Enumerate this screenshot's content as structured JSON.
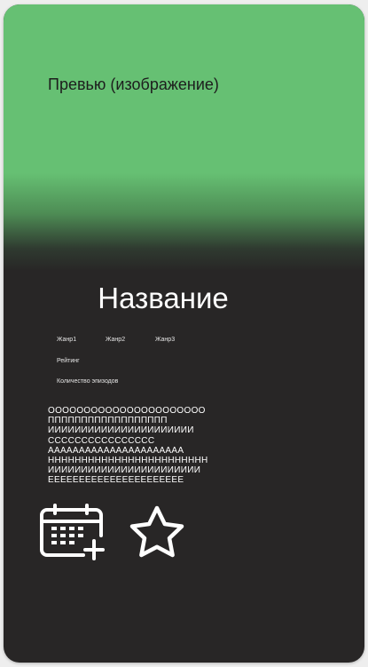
{
  "preview": {
    "label": "Превью (изображение)"
  },
  "title": "Название",
  "genres": [
    "Жанр1",
    "Жанр2",
    "Жанр3"
  ],
  "rating_label": "Рейтинг",
  "episodes_label": "Количество эпизодов",
  "description_lines": [
    "ОООООООООООООООООООООО",
    "ПППППППППППППППППП",
    "ИИИИИИИИИИИИИИИИИИИИИИ",
    "СССССССССССССССС",
    "АААААААААААААААААААААА",
    "НННННННННННННННННННННННН",
    "ИИИИИИИИИИИИИИИИИИИИИИИ",
    "ЕЕЕЕЕЕЕЕЕЕЕЕЕЕЕЕЕЕЕЕЕЕ"
  ],
  "actions": {
    "calendar_icon": "calendar-add-icon",
    "star_icon": "star-outline-icon"
  },
  "colors": {
    "preview_green": "#66c073",
    "card_background": "#282626",
    "text": "#ffffff"
  }
}
